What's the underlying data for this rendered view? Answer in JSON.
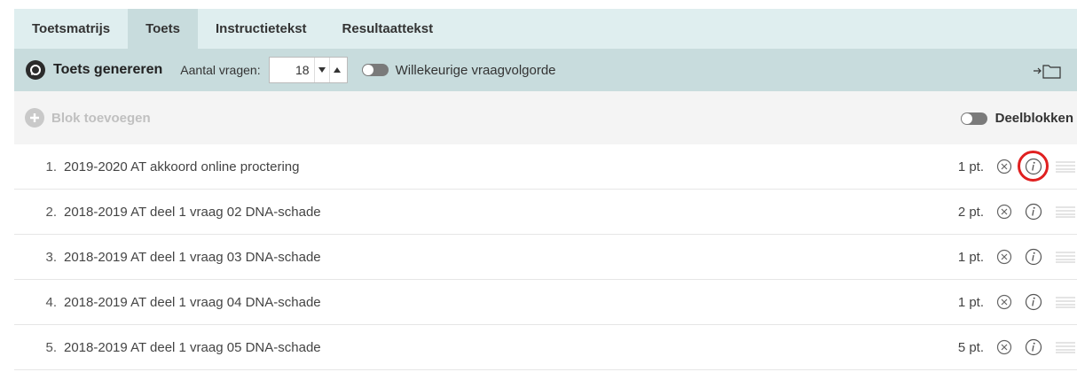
{
  "tabs": [
    {
      "label": "Toetsmatrijs",
      "active": false
    },
    {
      "label": "Toets",
      "active": true
    },
    {
      "label": "Instructietekst",
      "active": false
    },
    {
      "label": "Resultaattekst",
      "active": false
    }
  ],
  "toolbar": {
    "generate_label": "Toets genereren",
    "count_label": "Aantal vragen:",
    "count_value": "18",
    "random_order_label": "Willekeurige vraagvolgorde",
    "export_icon": "export-folder-icon"
  },
  "blockbar": {
    "add_label": "Blok toevoegen",
    "subblocks_label": "Deelblokken"
  },
  "items": [
    {
      "num": "1.",
      "title": "2019-2020 AT akkoord online proctering",
      "points": "1 pt."
    },
    {
      "num": "2.",
      "title": "2018-2019 AT deel 1 vraag 02 DNA-schade",
      "points": "2 pt."
    },
    {
      "num": "3.",
      "title": "2018-2019 AT deel 1 vraag 03 DNA-schade",
      "points": "1 pt."
    },
    {
      "num": "4.",
      "title": "2018-2019 AT deel 1 vraag 04 DNA-schade",
      "points": "1 pt."
    },
    {
      "num": "5.",
      "title": "2018-2019 AT deel 1 vraag 05 DNA-schade",
      "points": "5 pt."
    }
  ],
  "colors": {
    "tabbar": "#dfeeef",
    "toolbar": "#c8dcdd",
    "highlight": "#e02020"
  }
}
